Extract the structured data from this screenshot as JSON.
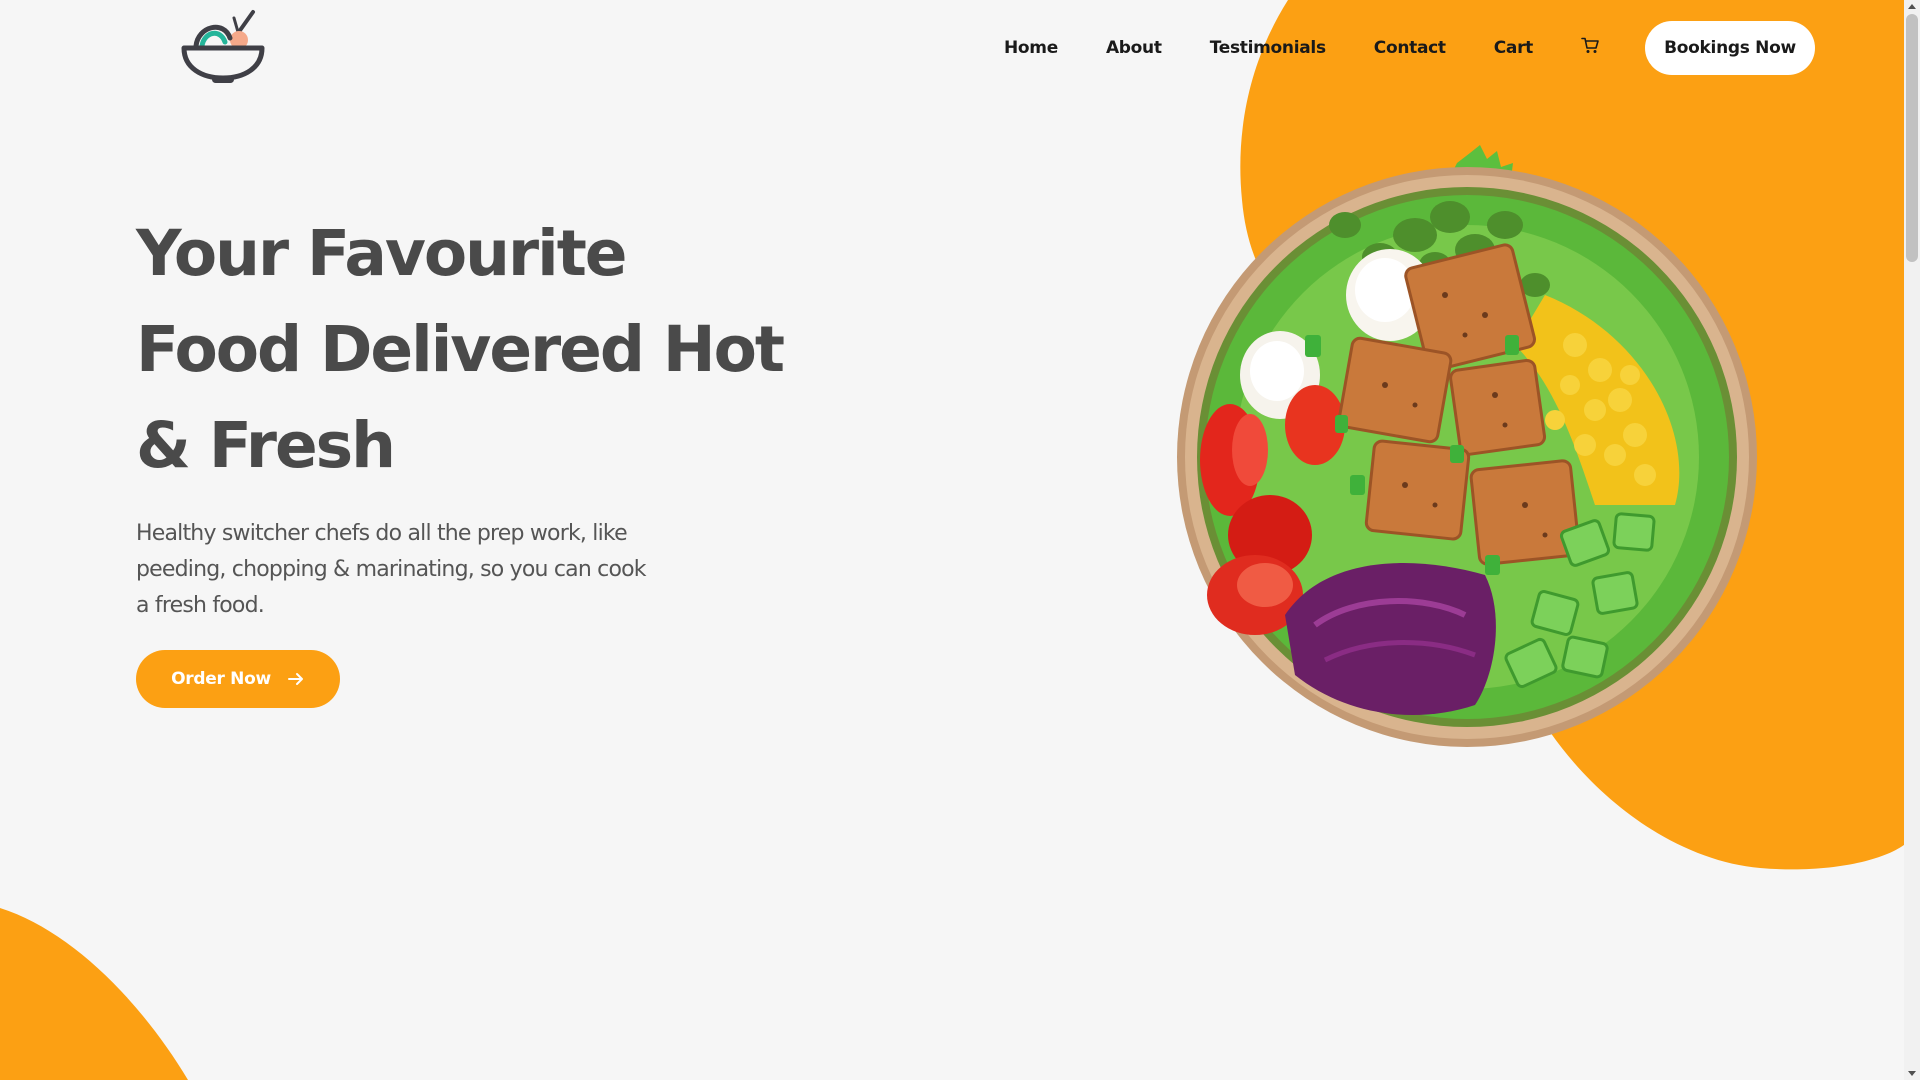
{
  "colors": {
    "accent": "#fca013",
    "background": "#f6f6f6",
    "heading": "#4a4a4a",
    "body_text": "#555555",
    "nav_text": "#1a1a1a",
    "logo_dark": "#3f3f46",
    "logo_teal": "#24b59a",
    "logo_peach": "#f5a98a"
  },
  "header": {
    "logo_icon": "bowl-logo-icon",
    "nav": {
      "items": [
        {
          "label": "Home"
        },
        {
          "label": "About"
        },
        {
          "label": "Testimonials"
        },
        {
          "label": "Contact"
        },
        {
          "label": "Cart"
        }
      ],
      "cart_icon": "shopping-cart-icon",
      "booking_label": "Bookings Now"
    }
  },
  "hero": {
    "title": "Your Favourite Food Delivered Hot & Fresh",
    "description": "Healthy switcher chefs do all the prep work, like peeding, chopping & marinating, so you can cook a fresh food.",
    "cta_label": "Order Now",
    "cta_icon": "arrow-right-icon",
    "image_icon": "salad-bowl-image"
  }
}
